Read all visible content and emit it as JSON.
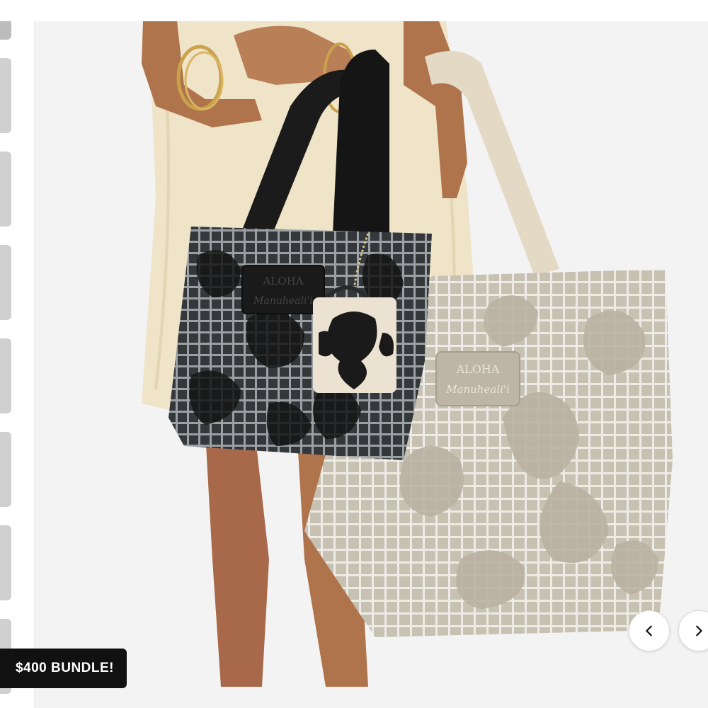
{
  "promo_badge": {
    "text": "$400 BUNDLE!",
    "background": "#111111",
    "color": "#ffffff"
  },
  "gallery": {
    "thumbnail_count": 8,
    "prev_icon": "chevron-left-icon",
    "next_icon": "chevron-right-icon"
  },
  "colors": {
    "dress": "#efe3c8",
    "skin": "#b0744c",
    "dark_bag": "#2f3133",
    "light_bag": "#c9c3b4",
    "strap_dark": "#1b1b1b",
    "strap_light": "#e4d9c5",
    "background": "#f3f3f3"
  },
  "product": {
    "logo_text": "ALOHA",
    "brand_script": "Manuheali'i"
  }
}
